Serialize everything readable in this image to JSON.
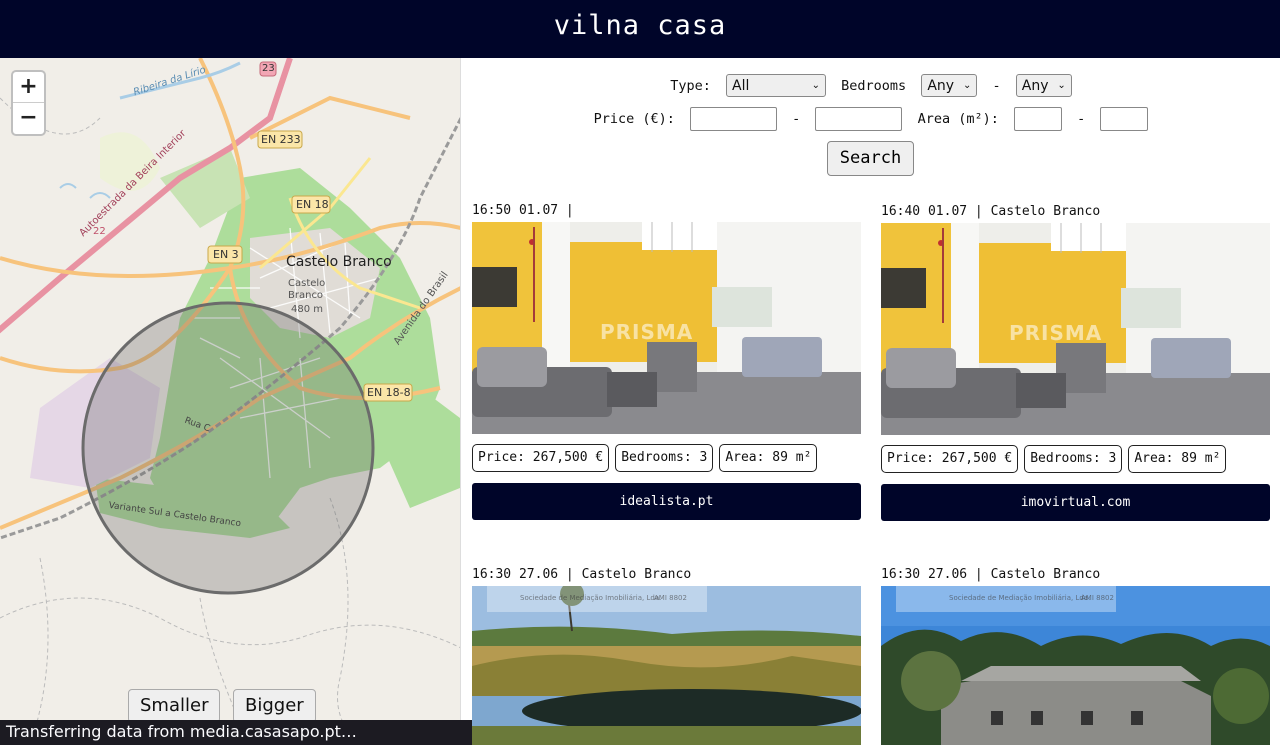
{
  "header": {
    "title": "vilna casa"
  },
  "map": {
    "zoom_in": "+",
    "zoom_out": "−",
    "smaller_label": "Smaller",
    "bigger_label": "Bigger",
    "labels": {
      "road_a23": "23",
      "road_en233": "EN 233",
      "road_en18": "EN 18",
      "road_en3": "EN 3",
      "road_en188": "EN 18-8",
      "road_22": "22",
      "city": "Castelo Branco",
      "peak_name": "Castelo Branco",
      "peak_elev": "480 m",
      "river": "Ribeira da Lírio",
      "motorway": "Autoestrada da Beira Interior",
      "avenida": "Avenida do Brasil",
      "rua": "Rua C",
      "variante": "Variante Sul a Castelo Branco"
    }
  },
  "status_bar": {
    "text": "Transferring data from media.casasapo.pt…"
  },
  "filters": {
    "type_label": "Type:",
    "type_value": "All",
    "bedrooms_label": "Bedrooms",
    "bedrooms_min": "Any",
    "bedrooms_max": "Any",
    "dash": "-",
    "price_label": "Price (€):",
    "area_label": "Area (m²):",
    "search_label": "Search"
  },
  "listings": [
    {
      "time": "16:50 01.07",
      "location": "",
      "price": "Price: 267,500 €",
      "bedrooms": "Bedrooms: 3",
      "area": "Area: 89 m²",
      "source": "idealista.pt"
    },
    {
      "time": "16:40 01.07",
      "location": "Castelo Branco",
      "price": "Price: 267,500 €",
      "bedrooms": "Bedrooms: 3",
      "area": "Area: 89 m²",
      "source": "imovirtual.com"
    },
    {
      "time": "16:30 27.06",
      "location": "Castelo Branco",
      "price": "",
      "bedrooms": "",
      "area": "",
      "source": ""
    },
    {
      "time": "16:30 27.06",
      "location": "Castelo Branco",
      "price": "",
      "bedrooms": "",
      "area": "",
      "source": ""
    }
  ],
  "watermarks": {
    "prisma": "PRISMA",
    "agency": "Sociedade de Mediação Imobiliária, Lda.",
    "ami": "AMI 8802"
  },
  "colors": {
    "header_bg": "#000529",
    "source_button_bg": "#000529",
    "map_green": "#a9d19a",
    "circle_fill": "rgba(90,90,90,0.28)"
  }
}
